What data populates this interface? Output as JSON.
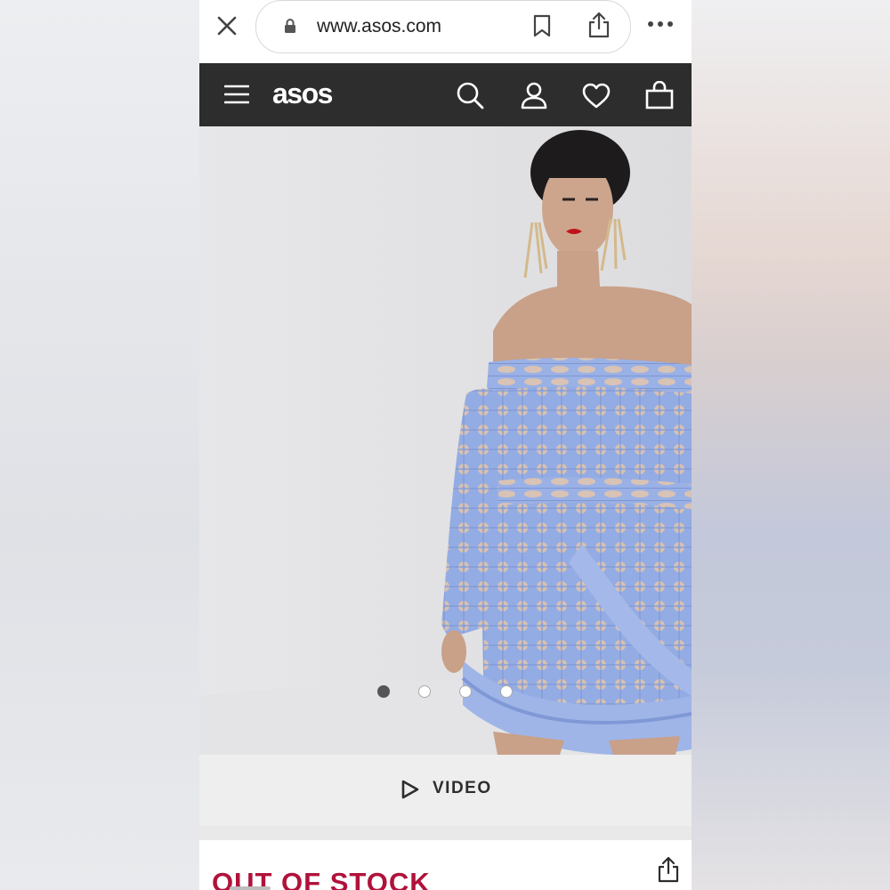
{
  "browser": {
    "url": "www.asos.com",
    "icons": [
      "close-icon",
      "lock-icon",
      "bookmark-icon",
      "share-icon",
      "more-icon"
    ]
  },
  "header": {
    "logo": "asos",
    "icons": [
      "menu-icon",
      "search-icon",
      "account-icon",
      "wishlist-icon",
      "bag-icon"
    ]
  },
  "product": {
    "carousel": {
      "total": 4,
      "active": 1
    },
    "video_label": "VIDEO",
    "stock_status": "OUT OF STOCK"
  },
  "colors": {
    "header_bg": "#2d2d2d",
    "stock_red": "#b0123b",
    "dress_blue": "#8fa9e0"
  }
}
